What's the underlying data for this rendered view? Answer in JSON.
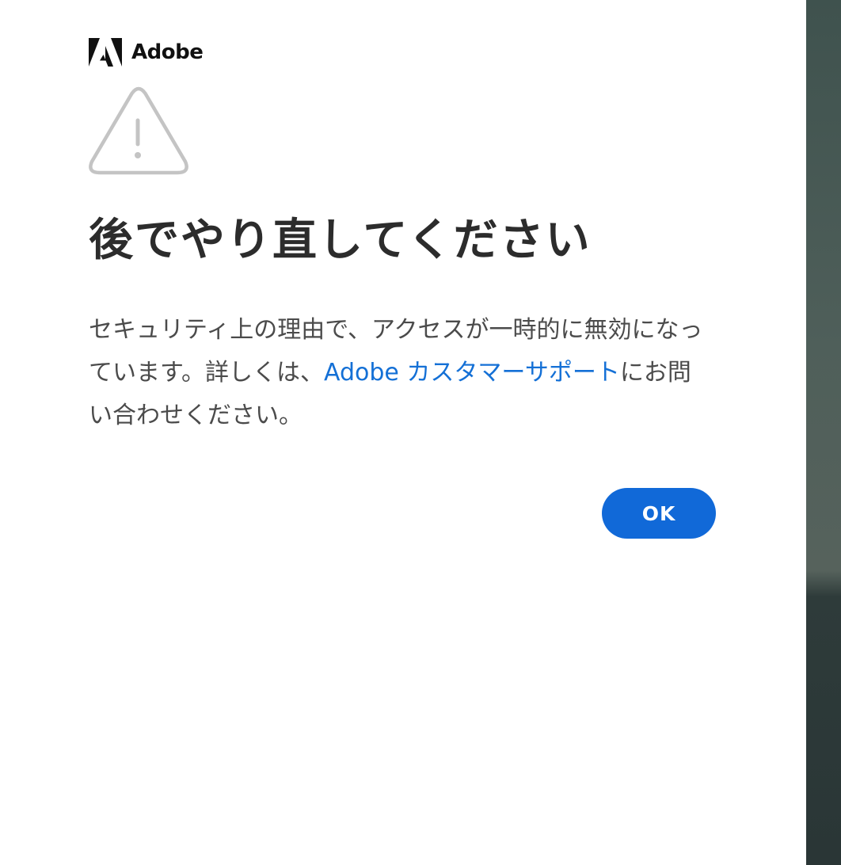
{
  "brand": {
    "name": "Adobe",
    "logo_icon": "adobe-logo-icon"
  },
  "alert": {
    "icon": "warning-triangle-icon",
    "title": "後でやり直してください",
    "message_before": "セキュリティ上の理由で、アクセスが一時的に無効になっています。詳しくは、",
    "support_link": "Adobe カスタマーサポート",
    "message_after": "にお問い合わせください。"
  },
  "actions": {
    "ok_label": "OK"
  },
  "colors": {
    "accent": "#1169d8",
    "link": "#1470d6",
    "title": "#2c2c2c",
    "body_text": "#4b4b4b",
    "icon_gray": "#c4c4c4",
    "side_panel": "#4f5f5a"
  }
}
